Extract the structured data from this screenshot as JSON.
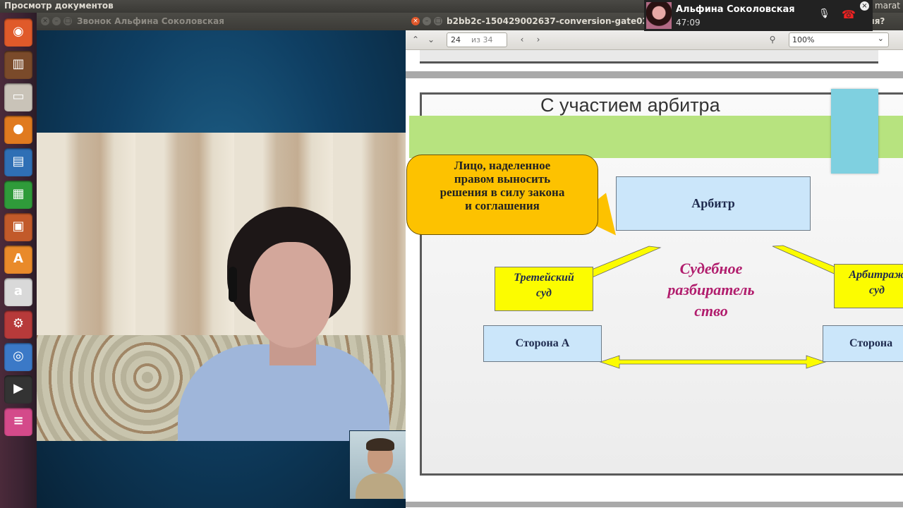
{
  "top_panel": {
    "app_title": "Просмотр документов",
    "user_label": "marat"
  },
  "launcher": {
    "items": [
      {
        "name": "ubuntu-home-icon",
        "color": "#e05a2a",
        "glyph": "◉"
      },
      {
        "name": "bookshelf-icon",
        "color": "#7a4a2a",
        "glyph": "▥"
      },
      {
        "name": "files-icon",
        "color": "#c9c3b8",
        "glyph": "▭"
      },
      {
        "name": "firefox-icon",
        "color": "#e07a1f",
        "glyph": "●"
      },
      {
        "name": "writer-icon",
        "color": "#2f6fb5",
        "glyph": "▤"
      },
      {
        "name": "calc-icon",
        "color": "#2f9b3a",
        "glyph": "▦"
      },
      {
        "name": "impress-icon",
        "color": "#c25a2a",
        "glyph": "▣"
      },
      {
        "name": "software-center-icon",
        "color": "#e98a2a",
        "glyph": "A"
      },
      {
        "name": "amazon-icon",
        "color": "#d9d9d9",
        "glyph": "a"
      },
      {
        "name": "settings-icon",
        "color": "#b73a3a",
        "glyph": "⚙"
      },
      {
        "name": "chromium-icon",
        "color": "#3b79c7",
        "glyph": "◎"
      },
      {
        "name": "video-editor-icon",
        "color": "#333333",
        "glyph": "▶"
      },
      {
        "name": "stacked-apps-icon",
        "color": "#d44a8a",
        "glyph": "≡"
      }
    ]
  },
  "call_window": {
    "title": "Звонок Альфина Соколовская"
  },
  "viewer": {
    "title": "b2bb2c-150429002637-conversion-gate02.pdf — К",
    "title_tail": "ния?",
    "page_current": "24",
    "page_total": "из 34",
    "zoom": "100%"
  },
  "slide": {
    "title": "С участием арбитра",
    "bubble_lines": [
      "Лицо, наделенное",
      "правом выносить",
      "решения в силу закона",
      "и соглашения"
    ],
    "arbiter": "Арбитр",
    "arbitration_court_lines": [
      "Третейский",
      "суд"
    ],
    "commercial_court_lines": [
      "Арбитраж",
      "суд"
    ],
    "proceedings_lines": [
      "Судебное",
      "разбиратель",
      "ство"
    ],
    "party_a": "Сторона А",
    "party_b": "Сторона"
  },
  "notification": {
    "name": "Альфина Соколовская",
    "time": "47:09"
  }
}
